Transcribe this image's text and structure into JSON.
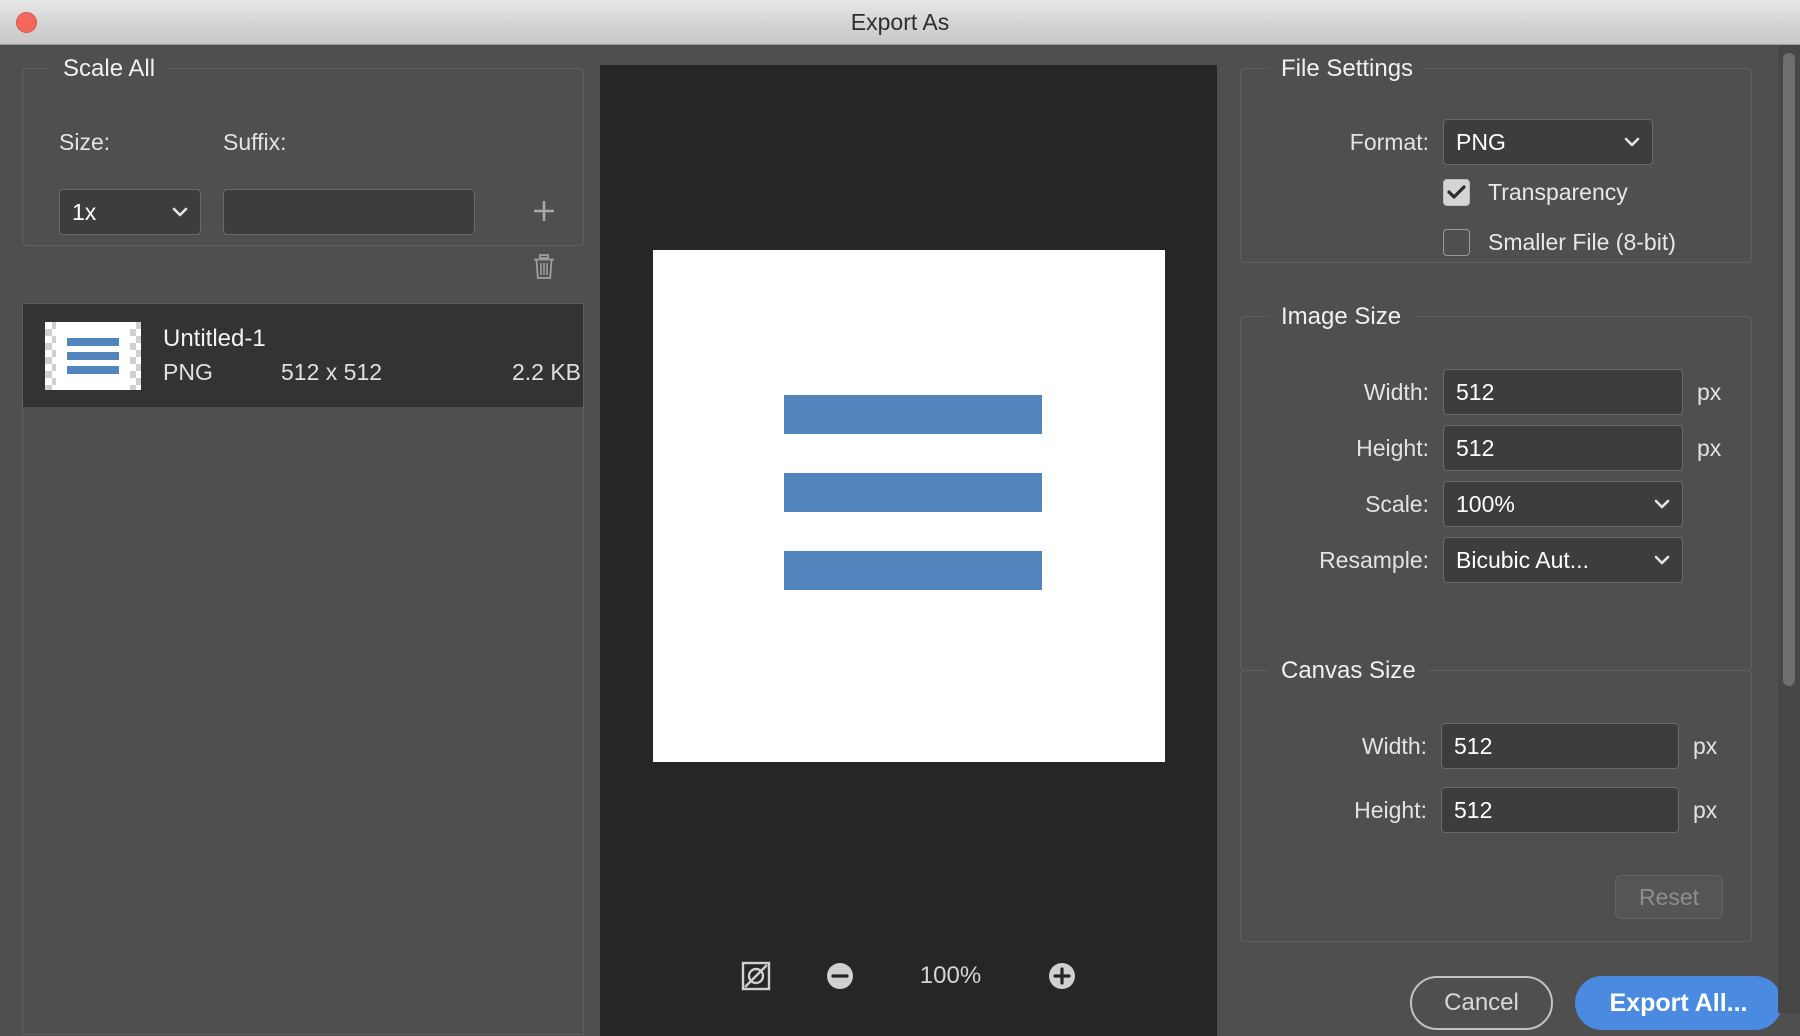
{
  "window": {
    "title": "Export As",
    "close_icon": "close-traffic-light"
  },
  "scale_all": {
    "group_title": "Scale All",
    "size_label": "Size:",
    "suffix_label": "Suffix:",
    "size_value": "1x",
    "suffix_value": "",
    "suffix_placeholder": "",
    "add_icon": "plus-icon",
    "delete_icon": "trash-icon"
  },
  "file_list": {
    "items": [
      {
        "name": "Untitled-1",
        "format": "PNG",
        "dimensions": "512 x 512",
        "size": "2.2 KB"
      }
    ]
  },
  "preview": {
    "zoom_level": "100%",
    "fit_icon": "fit-to-screen-icon",
    "zoom_out_icon": "minus-circle-icon",
    "zoom_in_icon": "plus-circle-icon",
    "bar_color": "#5285bd",
    "canvas_background": "#ffffff"
  },
  "file_settings": {
    "group_title": "File Settings",
    "format_label": "Format:",
    "format_value": "PNG",
    "transparency_label": "Transparency",
    "transparency_checked": true,
    "smaller_file_label": "Smaller File (8-bit)",
    "smaller_file_checked": false
  },
  "image_size": {
    "group_title": "Image Size",
    "width_label": "Width:",
    "width_value": "512",
    "width_unit": "px",
    "height_label": "Height:",
    "height_value": "512",
    "height_unit": "px",
    "scale_label": "Scale:",
    "scale_value": "100%",
    "resample_label": "Resample:",
    "resample_value": "Bicubic Aut..."
  },
  "canvas_size": {
    "group_title": "Canvas Size",
    "width_label": "Width:",
    "width_value": "512",
    "width_unit": "px",
    "height_label": "Height:",
    "height_value": "512",
    "height_unit": "px",
    "reset_label": "Reset"
  },
  "footer": {
    "cancel_label": "Cancel",
    "export_label": "Export All...",
    "accent_color": "#4a8ae0"
  }
}
